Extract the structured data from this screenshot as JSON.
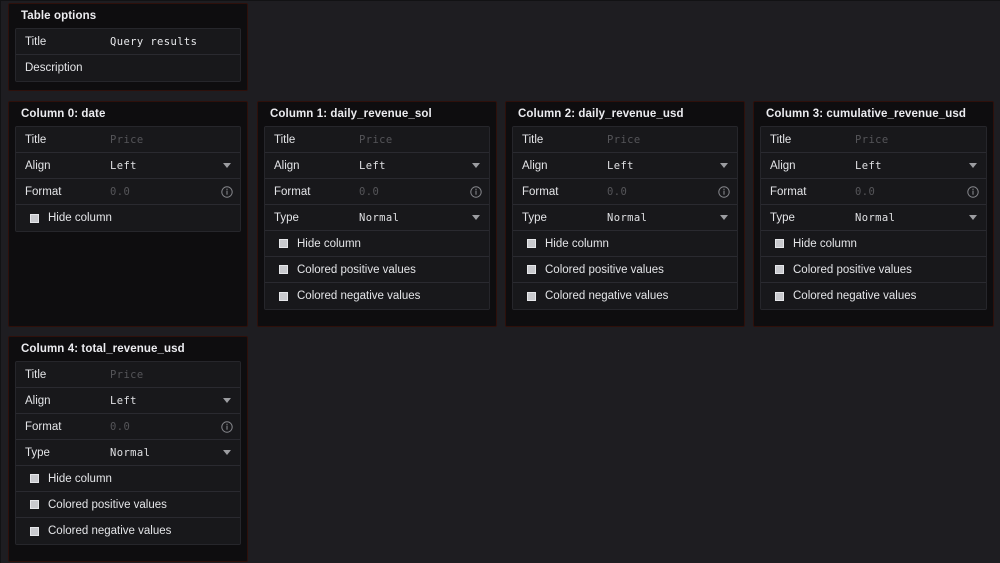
{
  "theme": {
    "page_bg": "#1e1d21",
    "panel_bg": "#0e0d0f",
    "panel_border": "#2e100b",
    "row_bg": "#18181b",
    "row_divider": "#2a2a30",
    "text": "#e4e5e8",
    "placeholder_text": "#555559",
    "checkbox_fill": "#c9cace",
    "caret_color": "#9c9da1"
  },
  "table_options": {
    "header": "Table options",
    "fields": [
      {
        "label": "Title",
        "value": "Query results",
        "placeholder": "Title",
        "state": "filled"
      },
      {
        "label": "Description",
        "value": "",
        "placeholder": "Description",
        "state": "empty"
      }
    ]
  },
  "labels": {
    "title": "Title",
    "align": "Align",
    "format": "Format",
    "type": "Type",
    "hide_column": "Hide column",
    "colored_positive": "Colored positive values",
    "colored_negative": "Colored negative values"
  },
  "placeholders": {
    "title": "Price",
    "format": "0.0"
  },
  "values": {
    "align": "Left",
    "type": "Normal"
  },
  "icons": {
    "caret": "chevron-down-icon",
    "info": "info-circle-icon",
    "checkbox": "checkbox-icon"
  },
  "columns": [
    {
      "header": "Column 0: date",
      "title_value": "",
      "align_value": "Left",
      "format_value": "",
      "type_value": null,
      "has_type": false,
      "checkboxes": [
        {
          "label": "Hide column",
          "checked": false
        }
      ]
    },
    {
      "header": "Column 1: daily_revenue_sol",
      "title_value": "",
      "align_value": "Left",
      "format_value": "",
      "type_value": "Normal",
      "has_type": true,
      "checkboxes": [
        {
          "label": "Hide column",
          "checked": false
        },
        {
          "label": "Colored positive values",
          "checked": false
        },
        {
          "label": "Colored negative values",
          "checked": false
        }
      ]
    },
    {
      "header": "Column 2: daily_revenue_usd",
      "title_value": "",
      "align_value": "Left",
      "format_value": "",
      "type_value": "Normal",
      "has_type": true,
      "checkboxes": [
        {
          "label": "Hide column",
          "checked": false
        },
        {
          "label": "Colored positive values",
          "checked": false
        },
        {
          "label": "Colored negative values",
          "checked": false
        }
      ]
    },
    {
      "header": "Column 3: cumulative_revenue_usd",
      "title_value": "",
      "align_value": "Left",
      "format_value": "",
      "type_value": "Normal",
      "has_type": true,
      "checkboxes": [
        {
          "label": "Hide column",
          "checked": false
        },
        {
          "label": "Colored positive values",
          "checked": false
        },
        {
          "label": "Colored negative values",
          "checked": false
        }
      ]
    },
    {
      "header": "Column 4: total_revenue_usd",
      "title_value": "",
      "align_value": "Left",
      "format_value": "",
      "type_value": "Normal",
      "has_type": true,
      "checkboxes": [
        {
          "label": "Hide column",
          "checked": false
        },
        {
          "label": "Colored positive values",
          "checked": false
        },
        {
          "label": "Colored negative values",
          "checked": false
        }
      ]
    }
  ]
}
